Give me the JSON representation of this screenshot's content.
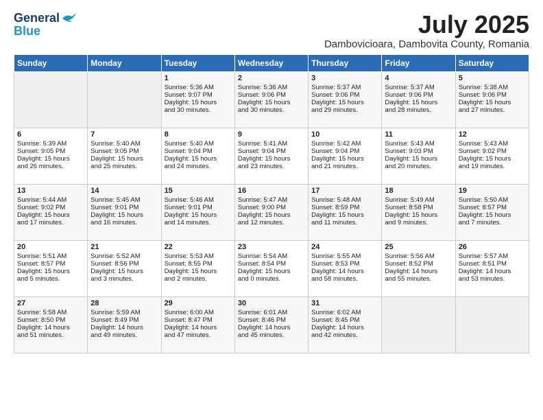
{
  "header": {
    "logo_general": "General",
    "logo_blue": "Blue",
    "month_year": "July 2025",
    "location": "Dambovicioara, Dambovita County, Romania"
  },
  "days_of_week": [
    "Sunday",
    "Monday",
    "Tuesday",
    "Wednesday",
    "Thursday",
    "Friday",
    "Saturday"
  ],
  "weeks": [
    [
      {
        "day": "",
        "info": ""
      },
      {
        "day": "",
        "info": ""
      },
      {
        "day": "1",
        "info": "Sunrise: 5:36 AM\nSunset: 9:07 PM\nDaylight: 15 hours\nand 30 minutes."
      },
      {
        "day": "2",
        "info": "Sunrise: 5:36 AM\nSunset: 9:06 PM\nDaylight: 15 hours\nand 30 minutes."
      },
      {
        "day": "3",
        "info": "Sunrise: 5:37 AM\nSunset: 9:06 PM\nDaylight: 15 hours\nand 29 minutes."
      },
      {
        "day": "4",
        "info": "Sunrise: 5:37 AM\nSunset: 9:06 PM\nDaylight: 15 hours\nand 28 minutes."
      },
      {
        "day": "5",
        "info": "Sunrise: 5:38 AM\nSunset: 9:06 PM\nDaylight: 15 hours\nand 27 minutes."
      }
    ],
    [
      {
        "day": "6",
        "info": "Sunrise: 5:39 AM\nSunset: 9:05 PM\nDaylight: 15 hours\nand 26 minutes."
      },
      {
        "day": "7",
        "info": "Sunrise: 5:40 AM\nSunset: 9:05 PM\nDaylight: 15 hours\nand 25 minutes."
      },
      {
        "day": "8",
        "info": "Sunrise: 5:40 AM\nSunset: 9:04 PM\nDaylight: 15 hours\nand 24 minutes."
      },
      {
        "day": "9",
        "info": "Sunrise: 5:41 AM\nSunset: 9:04 PM\nDaylight: 15 hours\nand 23 minutes."
      },
      {
        "day": "10",
        "info": "Sunrise: 5:42 AM\nSunset: 9:04 PM\nDaylight: 15 hours\nand 21 minutes."
      },
      {
        "day": "11",
        "info": "Sunrise: 5:43 AM\nSunset: 9:03 PM\nDaylight: 15 hours\nand 20 minutes."
      },
      {
        "day": "12",
        "info": "Sunrise: 5:43 AM\nSunset: 9:02 PM\nDaylight: 15 hours\nand 19 minutes."
      }
    ],
    [
      {
        "day": "13",
        "info": "Sunrise: 5:44 AM\nSunset: 9:02 PM\nDaylight: 15 hours\nand 17 minutes."
      },
      {
        "day": "14",
        "info": "Sunrise: 5:45 AM\nSunset: 9:01 PM\nDaylight: 15 hours\nand 16 minutes."
      },
      {
        "day": "15",
        "info": "Sunrise: 5:46 AM\nSunset: 9:01 PM\nDaylight: 15 hours\nand 14 minutes."
      },
      {
        "day": "16",
        "info": "Sunrise: 5:47 AM\nSunset: 9:00 PM\nDaylight: 15 hours\nand 12 minutes."
      },
      {
        "day": "17",
        "info": "Sunrise: 5:48 AM\nSunset: 8:59 PM\nDaylight: 15 hours\nand 11 minutes."
      },
      {
        "day": "18",
        "info": "Sunrise: 5:49 AM\nSunset: 8:58 PM\nDaylight: 15 hours\nand 9 minutes."
      },
      {
        "day": "19",
        "info": "Sunrise: 5:50 AM\nSunset: 8:57 PM\nDaylight: 15 hours\nand 7 minutes."
      }
    ],
    [
      {
        "day": "20",
        "info": "Sunrise: 5:51 AM\nSunset: 8:57 PM\nDaylight: 15 hours\nand 5 minutes."
      },
      {
        "day": "21",
        "info": "Sunrise: 5:52 AM\nSunset: 8:56 PM\nDaylight: 15 hours\nand 3 minutes."
      },
      {
        "day": "22",
        "info": "Sunrise: 5:53 AM\nSunset: 8:55 PM\nDaylight: 15 hours\nand 2 minutes."
      },
      {
        "day": "23",
        "info": "Sunrise: 5:54 AM\nSunset: 8:54 PM\nDaylight: 15 hours\nand 0 minutes."
      },
      {
        "day": "24",
        "info": "Sunrise: 5:55 AM\nSunset: 8:53 PM\nDaylight: 14 hours\nand 58 minutes."
      },
      {
        "day": "25",
        "info": "Sunrise: 5:56 AM\nSunset: 8:52 PM\nDaylight: 14 hours\nand 55 minutes."
      },
      {
        "day": "26",
        "info": "Sunrise: 5:57 AM\nSunset: 8:51 PM\nDaylight: 14 hours\nand 53 minutes."
      }
    ],
    [
      {
        "day": "27",
        "info": "Sunrise: 5:58 AM\nSunset: 8:50 PM\nDaylight: 14 hours\nand 51 minutes."
      },
      {
        "day": "28",
        "info": "Sunrise: 5:59 AM\nSunset: 8:49 PM\nDaylight: 14 hours\nand 49 minutes."
      },
      {
        "day": "29",
        "info": "Sunrise: 6:00 AM\nSunset: 8:47 PM\nDaylight: 14 hours\nand 47 minutes."
      },
      {
        "day": "30",
        "info": "Sunrise: 6:01 AM\nSunset: 8:46 PM\nDaylight: 14 hours\nand 45 minutes."
      },
      {
        "day": "31",
        "info": "Sunrise: 6:02 AM\nSunset: 8:45 PM\nDaylight: 14 hours\nand 42 minutes."
      },
      {
        "day": "",
        "info": ""
      },
      {
        "day": "",
        "info": ""
      }
    ]
  ]
}
